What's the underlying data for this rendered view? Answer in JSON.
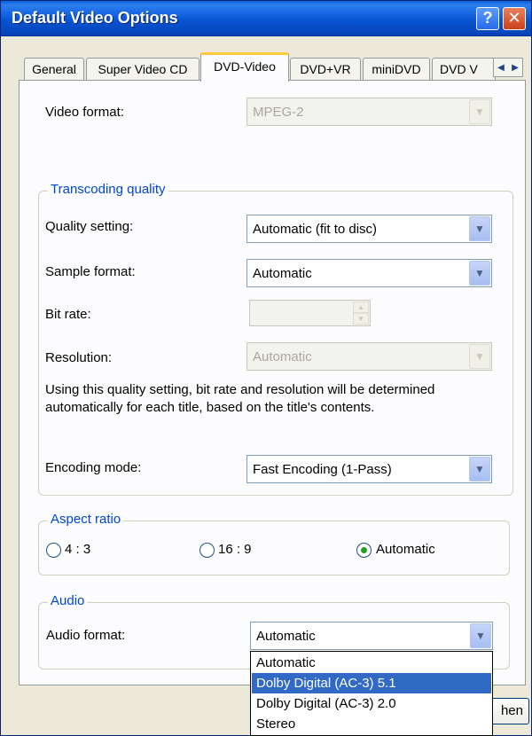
{
  "window": {
    "title": "Default Video Options",
    "help_label": "?",
    "close_label": "✕"
  },
  "tabs": [
    {
      "label": "General"
    },
    {
      "label": "Super Video CD"
    },
    {
      "label": "DVD-Video",
      "active": true
    },
    {
      "label": "DVD+VR"
    },
    {
      "label": "miniDVD"
    },
    {
      "label": "DVD V"
    }
  ],
  "tab_scroll": {
    "left": "◀",
    "right": "▶"
  },
  "video_format": {
    "label": "Video format:",
    "value": "MPEG-2",
    "disabled": true
  },
  "transcoding": {
    "legend": "Transcoding quality",
    "quality_setting": {
      "label": "Quality setting:",
      "value": "Automatic (fit to disc)"
    },
    "sample_format": {
      "label": "Sample format:",
      "value": "Automatic"
    },
    "bit_rate": {
      "label": "Bit rate:",
      "value": "",
      "disabled": true
    },
    "resolution": {
      "label": "Resolution:",
      "value": "Automatic",
      "disabled": true
    },
    "info_line1": "Using this quality setting, bit rate and resolution will be determined",
    "info_line2": "automatically for each title, based on the title's contents.",
    "encoding_mode": {
      "label": "Encoding mode:",
      "value": "Fast Encoding (1-Pass)"
    }
  },
  "aspect_ratio": {
    "legend": "Aspect ratio",
    "options": [
      {
        "label": "4 : 3",
        "selected": false
      },
      {
        "label": "16 : 9",
        "selected": false
      },
      {
        "label": "Automatic",
        "selected": true
      }
    ]
  },
  "audio": {
    "legend": "Audio",
    "format_label": "Audio format:",
    "format_value": "Automatic",
    "dropdown_options": [
      {
        "label": "Automatic",
        "highlighted": false
      },
      {
        "label": "Dolby Digital (AC-3) 5.1",
        "highlighted": true
      },
      {
        "label": "Dolby Digital (AC-3) 2.0",
        "highlighted": false
      },
      {
        "label": "Stereo",
        "highlighted": false
      }
    ]
  },
  "bottom_button_partial": "hen",
  "icons": {
    "combo_arrow": "chevron-down-icon",
    "radio": "radio-icon"
  },
  "colors": {
    "titlebar": "#0854d4",
    "legend": "#0046d5",
    "selection": "#316ac5",
    "active_tab_accent": "#ffc83c"
  }
}
